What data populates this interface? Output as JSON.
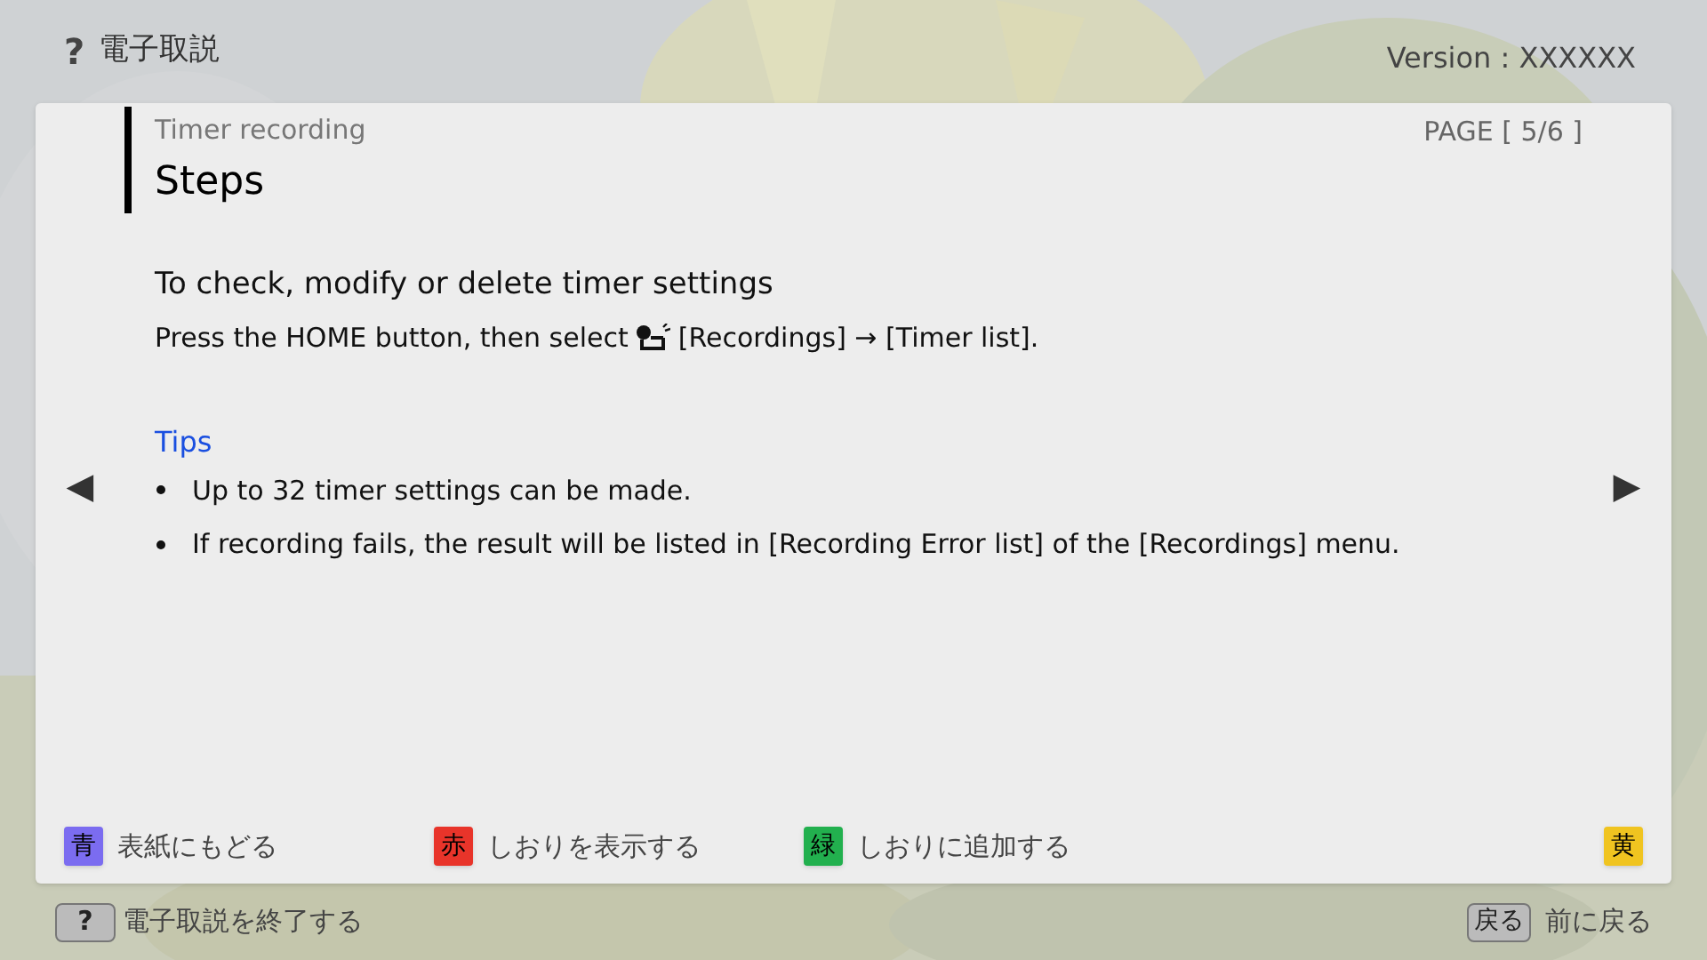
{
  "header": {
    "help_key": "?",
    "title": "電子取説",
    "version": "Version : XXXXXX"
  },
  "card": {
    "section": "Timer recording",
    "page": "PAGE [ 5/6 ]",
    "heading": "Steps",
    "subheading": "To check, modify or delete timer settings",
    "instruction_before": "Press the HOME button, then select",
    "instruction_after": "[Recordings] → [Timer list].",
    "tips_title": "Tips",
    "tips": [
      "Up to 32 timer settings can be made.",
      "If recording fails, the result will be listed in [Recording Error list] of the [Recordings] menu."
    ],
    "prev_arrow": "◀",
    "next_arrow": "▶",
    "color_keys": [
      {
        "key": "青",
        "color": "#7b6cf0",
        "label": "表紙にもどる"
      },
      {
        "key": "赤",
        "color": "#e8342a",
        "label": "しおりを表示する"
      },
      {
        "key": "緑",
        "color": "#22b04e",
        "label": "しおりに追加する"
      },
      {
        "key": "黄",
        "color": "#f0c420"
      }
    ]
  },
  "footer": {
    "left_key": "?",
    "left_label": "電子取説を終了する",
    "right_key": "戻る",
    "right_label": "前に戻る"
  }
}
